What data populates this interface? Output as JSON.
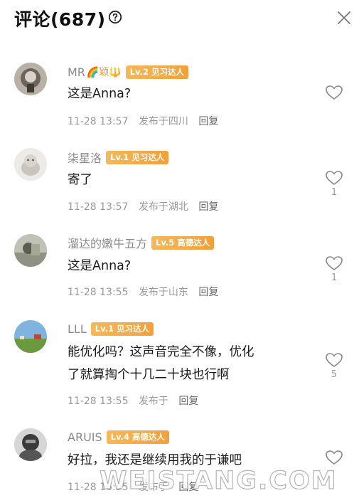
{
  "header": {
    "title": "评论(687)"
  },
  "comments": [
    {
      "username": "MR",
      "emoji": "🌈颖🔱",
      "badge": "Lv.2 见习达人",
      "content": "这是Anna?",
      "date": "11-28 13:57",
      "location": "发布于四川",
      "reply": "回复",
      "likes": ""
    },
    {
      "username": "柒星洛",
      "badge": "Lv.1 见习达人",
      "content": "寄了",
      "date": "11-28 13:57",
      "location": "发布于湖北",
      "reply": "回复",
      "likes": "1"
    },
    {
      "username": "溜达的嫩牛五方",
      "badge": "Lv.5 高德达人",
      "content": "这是Anna?",
      "date": "11-28 13:55",
      "location": "发布于山东",
      "reply": "回复",
      "likes": "1"
    },
    {
      "username": "LLL",
      "badge": "Lv.1 见习达人",
      "content_line1": "能优化吗？这声音完全不像，优化",
      "content_line2": "了就算掏个十几二十块也行啊",
      "date": "11-28 13:55",
      "location": "发布于",
      "reply": "回复",
      "likes": "5"
    },
    {
      "username": "ARUIS",
      "badge": "Lv.4 高德达人",
      "content": "好拉，我还是继续用我的于谦吧",
      "date": "11-28 16:55",
      "location": "发布于",
      "reply": "回复",
      "likes": ""
    }
  ],
  "watermark": "WEISTANG.COM",
  "colors": {
    "badge": "#f2a03b",
    "meta": "#999999",
    "username": "#8a8a8a"
  }
}
